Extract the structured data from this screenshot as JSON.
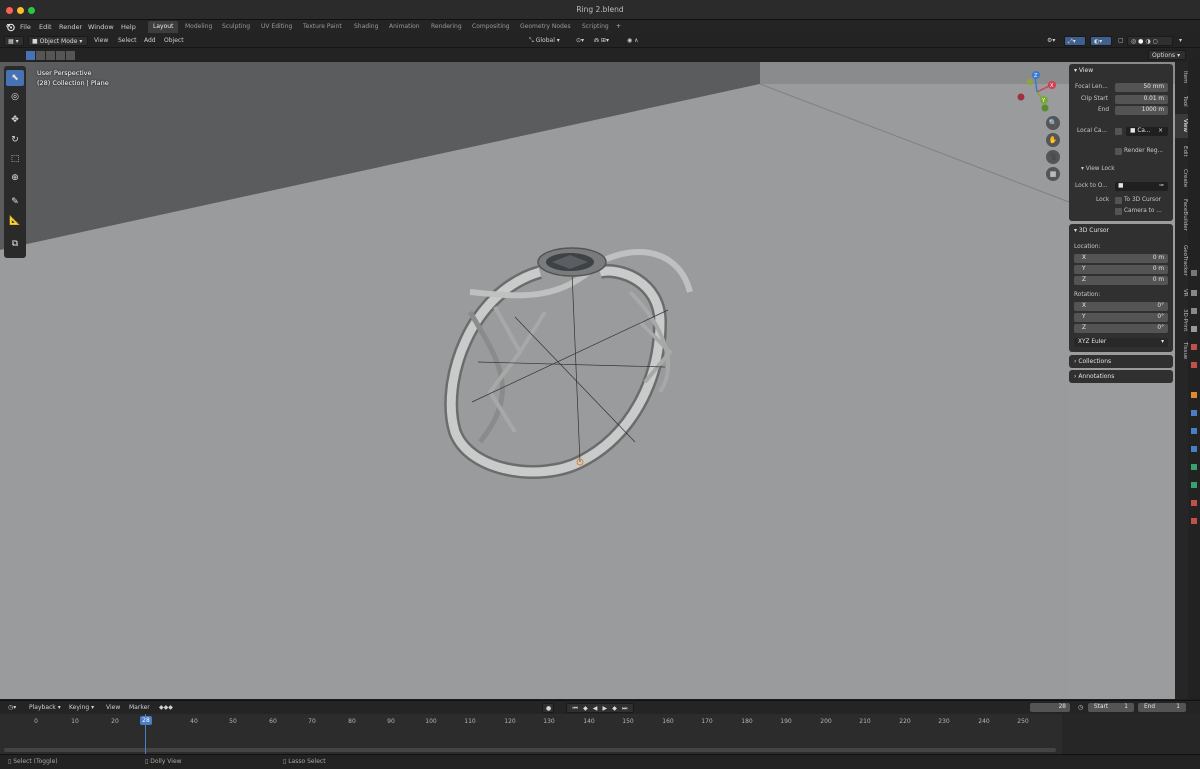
{
  "window": {
    "title": "Ring 2.blend"
  },
  "menus": [
    "File",
    "Edit",
    "Render",
    "Window",
    "Help"
  ],
  "workspaces": [
    "Layout",
    "Modeling",
    "Sculpting",
    "UV Editing",
    "Texture Paint",
    "Shading",
    "Animation",
    "Rendering",
    "Compositing",
    "Geometry Nodes",
    "Scripting"
  ],
  "active_workspace": "Layout",
  "viewport_header": {
    "mode": "Object Mode",
    "items": [
      "View",
      "Select",
      "Add",
      "Object"
    ],
    "orientation": "Global",
    "options_label": "Options"
  },
  "viewport": {
    "perspective": "User Perspective",
    "collection": "(28) Collection | Plane"
  },
  "gizmo": {
    "axes": [
      "X",
      "Y",
      "Z"
    ]
  },
  "npanel": {
    "view": {
      "title": "View",
      "focal_label": "Focal Len...",
      "focal_value": "50 mm",
      "clip_start_label": "Clip Start",
      "clip_start_value": "0.01 m",
      "end_label": "End",
      "end_value": "1000 m",
      "local_camera_label": "Local Ca...",
      "local_camera_value": "Ca...",
      "render_region_label": "Render Reg...",
      "view_lock_label": "View Lock",
      "lock_to_object_label": "Lock to O...",
      "lock_label": "Lock",
      "to_3d_cursor_label": "To 3D Cursor",
      "camera_to_label": "Camera to ..."
    },
    "cursor": {
      "title": "3D Cursor",
      "location_label": "Location:",
      "location": [
        {
          "axis": "X",
          "value": "0 m"
        },
        {
          "axis": "Y",
          "value": "0 m"
        },
        {
          "axis": "Z",
          "value": "0 m"
        }
      ],
      "rotation_label": "Rotation:",
      "rotation": [
        {
          "axis": "X",
          "value": "0°"
        },
        {
          "axis": "Y",
          "value": "0°"
        },
        {
          "axis": "Z",
          "value": "0°"
        }
      ],
      "rotation_mode": "XYZ Euler"
    },
    "collections_label": "Collections",
    "annotations_label": "Annotations"
  },
  "side_tabs": [
    "Item",
    "Tool",
    "View",
    "Edit",
    "Create",
    "FaceBuilder",
    "GeoTracker",
    "VR",
    "3D-Print",
    "Tissue"
  ],
  "active_side_tab": "View",
  "timeline": {
    "menus": [
      "Playback",
      "Keying",
      "View",
      "Marker"
    ],
    "current_frame": "28",
    "start_label": "Start",
    "start_value": "1",
    "end_label": "End",
    "end_value": "1",
    "ticks": [
      "0",
      "10",
      "20",
      "28",
      "40",
      "50",
      "60",
      "70",
      "80",
      "90",
      "100",
      "110",
      "120",
      "130",
      "140",
      "150",
      "160",
      "170",
      "180",
      "190",
      "200",
      "210",
      "220",
      "230",
      "240",
      "250"
    ]
  },
  "statusbar": {
    "select": "Select (Toggle)",
    "dolly": "Dolly View",
    "lasso": "Lasso Select"
  },
  "colors": {
    "accent": "#4772b3",
    "viewport_bg": "#9b9c9d",
    "panel": "#303030"
  }
}
